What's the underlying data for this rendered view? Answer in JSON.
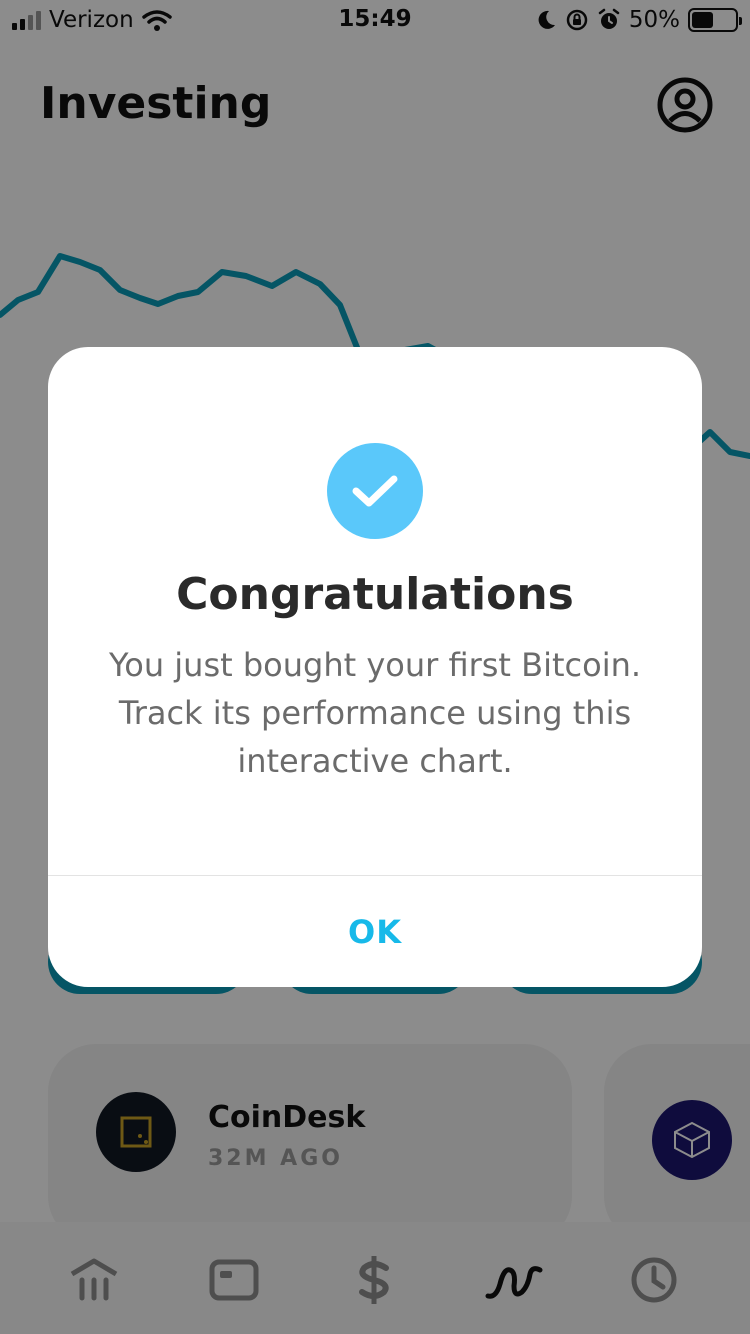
{
  "status_bar": {
    "carrier": "Verizon",
    "time": "15:49",
    "battery": "50%",
    "battery_level": 0.5,
    "icons": [
      "signal-icon",
      "wifi-icon",
      "moon-icon",
      "orientation-lock-icon",
      "alarm-icon",
      "battery-icon"
    ]
  },
  "header": {
    "title": "Investing",
    "profile_icon": "profile-icon"
  },
  "news": {
    "cards": [
      {
        "source": "CoinDesk",
        "time": "32M AGO"
      }
    ]
  },
  "tab_bar": {
    "items": [
      "bank-icon",
      "card-icon",
      "dollar-icon",
      "investing-icon",
      "activity-icon"
    ],
    "active": "investing-icon"
  },
  "modal": {
    "icon": "checkmark-icon",
    "title": "Congratulations",
    "body": "You just bought your first Bitcoin. Track its performance using this interactive chart.",
    "ok_label": "OK"
  },
  "colors": {
    "accent": "#17b9e9",
    "check": "#5ac8fa",
    "chart_line": "#0a9cb8",
    "overlay": "rgba(0,0,0,0.45)"
  }
}
